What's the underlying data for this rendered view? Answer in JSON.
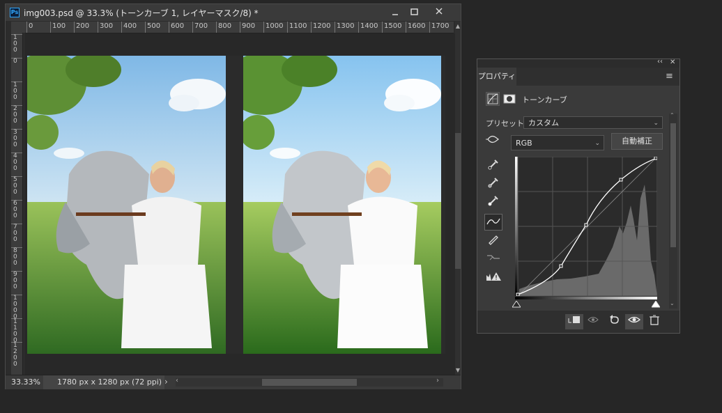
{
  "document": {
    "ps_logo": "Ps",
    "title": "img003.psd @ 33.3% (トーンカーブ 1, レイヤーマスク/8) *",
    "window_controls": [
      "minimize-icon",
      "restore-icon",
      "close-icon"
    ],
    "ruler_h_labels": [
      "0",
      "100",
      "200",
      "300",
      "400",
      "500",
      "600",
      "700",
      "800",
      "900",
      "1000",
      "1100",
      "1200",
      "1300",
      "1400",
      "1500",
      "1600",
      "1700"
    ],
    "ruler_v_labels": [
      "100",
      "0",
      "100",
      "200",
      "300",
      "400",
      "500",
      "600",
      "700",
      "800",
      "900",
      "1000",
      "1100",
      "1200"
    ],
    "zoom": "33.33%",
    "doc_info": "1780 px x 1280 px (72 ppi)",
    "status_arrow": "›"
  },
  "properties": {
    "collapse_icon": "‹‹",
    "close_icon": "✕",
    "tab_label": "プロパティ",
    "menu_icon": "≡",
    "adjustment_title": "トーンカーブ",
    "preset_label": "プリセット :",
    "preset_value": "カスタム",
    "channel_value": "RGB",
    "auto_button": "自動補正",
    "tools": [
      "target-adjust-icon",
      "eyedropper-black-icon",
      "eyedropper-gray-icon",
      "eyedropper-white-icon",
      "curve-point-icon",
      "pencil-icon",
      "smooth-icon",
      "clipping-warning-icon"
    ],
    "bottom_icons": [
      "clip-to-layer-icon",
      "view-previous-icon",
      "reset-icon",
      "visibility-icon",
      "delete-icon"
    ]
  }
}
